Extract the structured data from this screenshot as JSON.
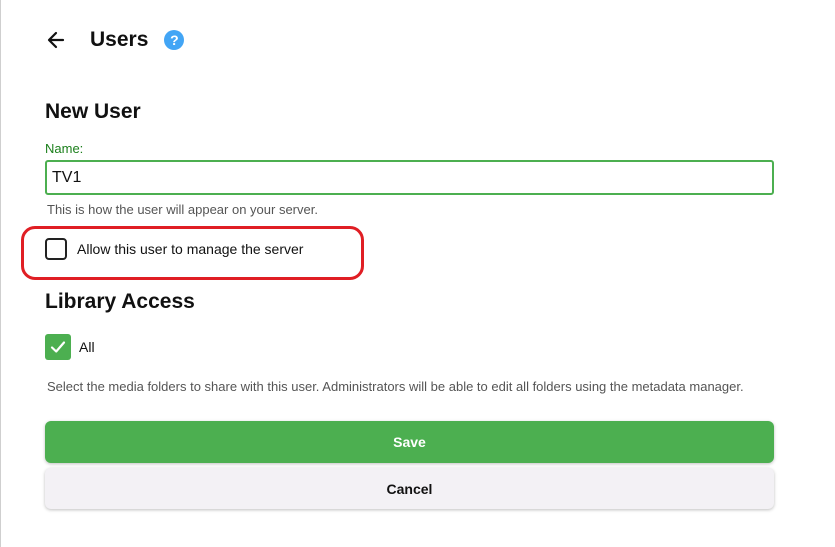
{
  "header": {
    "title": "Users",
    "back_icon": "arrow-left-icon",
    "help_icon": "question-mark-icon",
    "help_glyph": "?"
  },
  "new_user": {
    "title": "New User",
    "name_label": "Name:",
    "name_value": "TV1",
    "name_help": "This is how the user will appear on your server.",
    "admin_checkbox_label": "Allow this user to manage the server",
    "admin_checked": false
  },
  "library_access": {
    "title": "Library Access",
    "all_label": "All",
    "all_checked": true,
    "help": "Select the media folders to share with this user. Administrators will be able to edit all folders using the metadata manager."
  },
  "actions": {
    "save_label": "Save",
    "cancel_label": "Cancel"
  },
  "colors": {
    "accent_green": "#4caf50",
    "help_blue": "#42a5f5",
    "highlight_red": "#e01e24"
  }
}
